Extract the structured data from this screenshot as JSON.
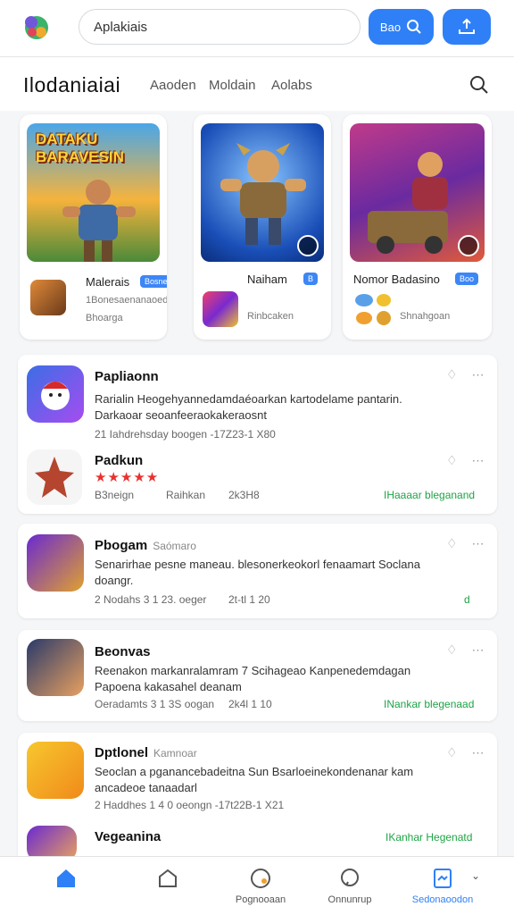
{
  "search": {
    "value": "Aplakiais",
    "btn_label": "Bao"
  },
  "header": {
    "title": "Ilodaniaiai",
    "tabs": [
      "Aaoden",
      "Moldain",
      "Aolabs"
    ]
  },
  "featured": [
    {
      "art_text": "DATAKU BARAVESIN",
      "name": "Malerais",
      "badge": "Bosner",
      "line1": "1Bonesaenanaoedan",
      "line2": "Bhoarga"
    },
    {
      "name": "Naiham",
      "badge": "B",
      "line2": "Rinbcaken"
    },
    {
      "name": "Nomor Badasino",
      "badge": "Boo",
      "line2": "Shnahgoan"
    }
  ],
  "cards": [
    {
      "name": "Papliaonn",
      "desc1": "Rarialin Heogehyannedamdaéoarkan kartodelame pantarin.",
      "desc2": "Darkaoar seoanfeeraokakeraosnt",
      "meta": "21 Iahdrehsday boogen -17Z23-1 X80"
    },
    {
      "name": "Padkun",
      "stars": "★★★★★",
      "meta1": "B3neign",
      "meta2": "Raihkan",
      "meta3": "2k3H8",
      "green": "IHaaaar bleganand"
    },
    {
      "name": "Pbogam",
      "sub": "Saómaro",
      "desc1": "Senarirhae pesne maneau. blesonerkeokorl fenaamart Soclana",
      "desc2": "doangr.",
      "meta": "2 Nodahs 3 1 23. oeger",
      "meta2": "2t-tl 1 20",
      "green": "d"
    },
    {
      "name": "Beonvas",
      "desc1": "Reenakon markanralamram 7 Scihageao Kanpenedemdagan",
      "desc2": "Papoena kakasahel deanam",
      "meta": "Oeradamts 3 1 3S oogan",
      "meta2": "2k4l 1 10",
      "green": "INankar blegenaad"
    },
    {
      "name": "Dptlonel",
      "sub": "Kamnoar",
      "desc1": "Seoclan a pganancebadeitna Sun Bsarloeinekondenanar kam",
      "desc2": "ancadeoe tanaadarl",
      "meta": "2 Haddhes 1 4 0 oeongn -17t22B-1 X21"
    },
    {
      "name": "Vegeanina",
      "green": "IKanhar Hegenatd"
    }
  ],
  "nav": [
    "",
    "",
    "Pognooaan",
    "Onnunrup",
    "Sedonaoodon"
  ],
  "colors": {
    "accent": "#2f80f6",
    "green": "#1ea446",
    "star": "#e8312f"
  }
}
